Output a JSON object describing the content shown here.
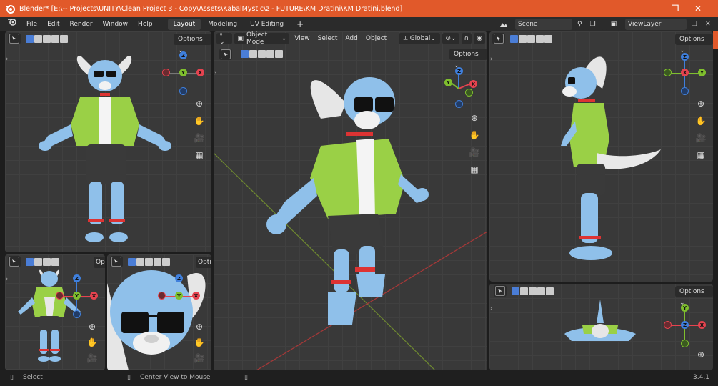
{
  "window": {
    "title": "Blender* [E:\\-- Projects\\UNITY\\Clean Project 3 - Copy\\Assets\\KabalMystic\\z - FUTURE\\KM Dratini\\KM Dratini.blend]",
    "controls": {
      "minimize": "–",
      "maximize": "❐",
      "close": "✕"
    }
  },
  "menu": [
    "File",
    "Edit",
    "Render",
    "Window",
    "Help"
  ],
  "workspaces": [
    "Layout",
    "Modeling",
    "UV Editing"
  ],
  "add_workspace": "+",
  "scene": {
    "label": "Scene",
    "viewlayer": "ViewLayer"
  },
  "main_viewport": {
    "mode": "Object Mode",
    "menus": [
      "View",
      "Select",
      "Add",
      "Object"
    ],
    "transform": "Global",
    "options": "Options"
  },
  "viewports": {
    "options": "Options",
    "options_short": "Opti",
    "options_cut": "Opt"
  },
  "gizmo_axes": {
    "x": "X",
    "y": "Y",
    "z": "Z"
  },
  "status": {
    "select": "Select",
    "center": "Center View to Mouse",
    "version": "3.4.1"
  },
  "colors": {
    "accent": "#e1592a",
    "axis_x": "#e5434f",
    "axis_y": "#7fbf2e",
    "axis_z": "#3f7fdc",
    "character_body": "#8fc0ea",
    "character_shirt": "#9ad046",
    "character_shorts": "#3a3a3a"
  }
}
